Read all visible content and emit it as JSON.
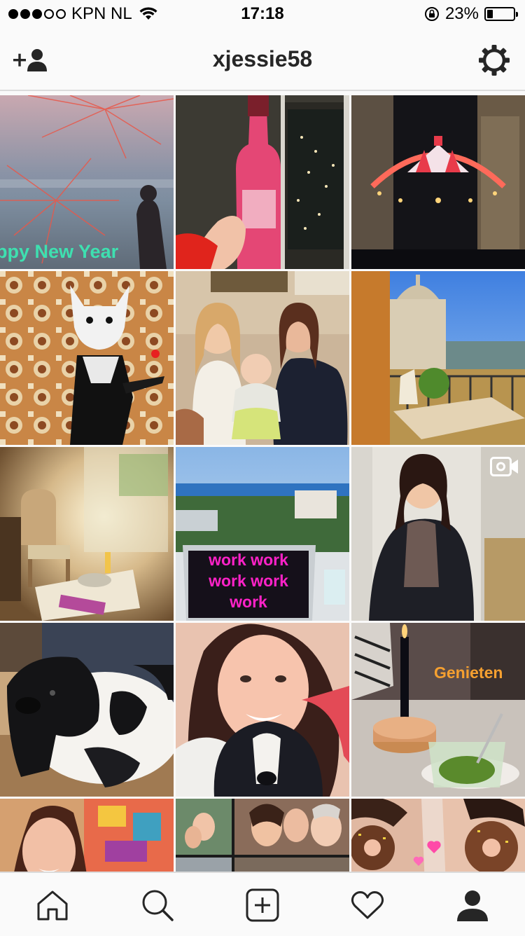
{
  "status_bar": {
    "carrier": "KPN NL",
    "signal_bars_filled": 3,
    "signal_bars_total": 5,
    "time": "17:18",
    "battery_percent": "23%",
    "battery_level": 0.23
  },
  "header": {
    "username": "xjessie58",
    "add_user_icon": "add-user-icon",
    "settings_icon": "gear-icon"
  },
  "grid": {
    "tiles": [
      {
        "name": "fireworks-beach",
        "label": "ppy New Year",
        "label_color": "#3ee0b0"
      },
      {
        "name": "porto-cruz-pink-bottle",
        "label": ""
      },
      {
        "name": "lisbon-street-lights",
        "label": ""
      },
      {
        "name": "cat-woman-street-art",
        "label": ""
      },
      {
        "name": "family-with-baby",
        "label": ""
      },
      {
        "name": "balcony-church-view",
        "label": ""
      },
      {
        "name": "sunlit-living-room",
        "label": ""
      },
      {
        "name": "laptop-sea-view",
        "label": "work work work work work",
        "label_color": "#ff22c8",
        "video": false
      },
      {
        "name": "woman-portrait",
        "label": "",
        "video": true,
        "video_icon": "video-camera-icon"
      },
      {
        "name": "black-white-dog",
        "label": ""
      },
      {
        "name": "selfie-with-puppy",
        "label": ""
      },
      {
        "name": "candle-mint-tea",
        "label": "Genieten",
        "label_color": "#f5a030"
      },
      {
        "name": "selfie-street-art",
        "label": ""
      },
      {
        "name": "group-collage",
        "label": ""
      },
      {
        "name": "donut-eyes",
        "label": ""
      }
    ]
  },
  "tab_bar": {
    "items": [
      {
        "icon": "home-icon",
        "active": false
      },
      {
        "icon": "search-icon",
        "active": false
      },
      {
        "icon": "add-post-icon",
        "active": false
      },
      {
        "icon": "heart-icon",
        "active": false
      },
      {
        "icon": "profile-icon",
        "active": true
      }
    ]
  }
}
